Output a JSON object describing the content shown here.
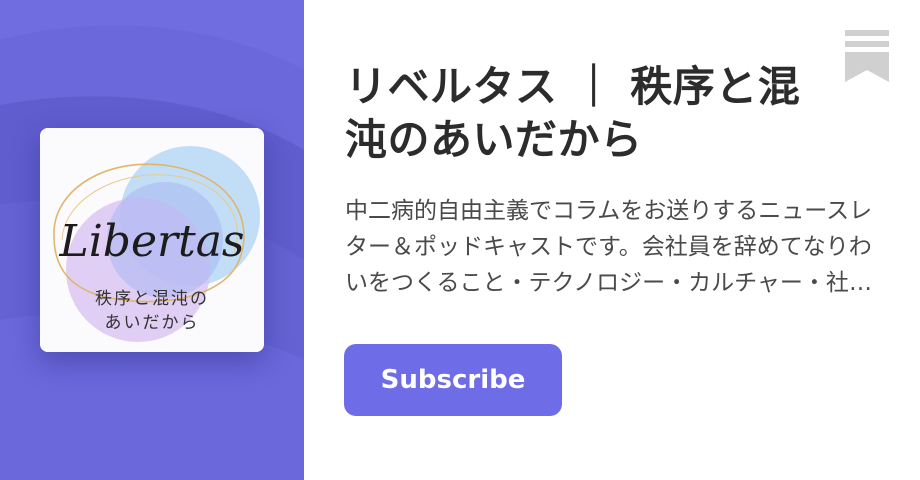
{
  "publication": {
    "title": "リベルタス ｜ 秩序と混沌のあいだから",
    "description": "中二病的自由主義でコラムをお送りするニュースレター＆ポッドキャストです。会社員を辞めてなりわいをつくること・テクノロジー・カルチャー・社会について発信しています。",
    "cover": {
      "wordmark": "Libertas",
      "subtitle_line1": "秩序と混沌の",
      "subtitle_line2": "あいだから"
    }
  },
  "actions": {
    "subscribe_label": "Subscribe",
    "bookmark_icon": "bookmark-icon"
  },
  "colors": {
    "panel": "#6664d6",
    "accent": "#6f6ce8",
    "title_text": "#2c2c2c",
    "body_text": "#4a4a4a",
    "bookmark": "#d0d0d0"
  }
}
